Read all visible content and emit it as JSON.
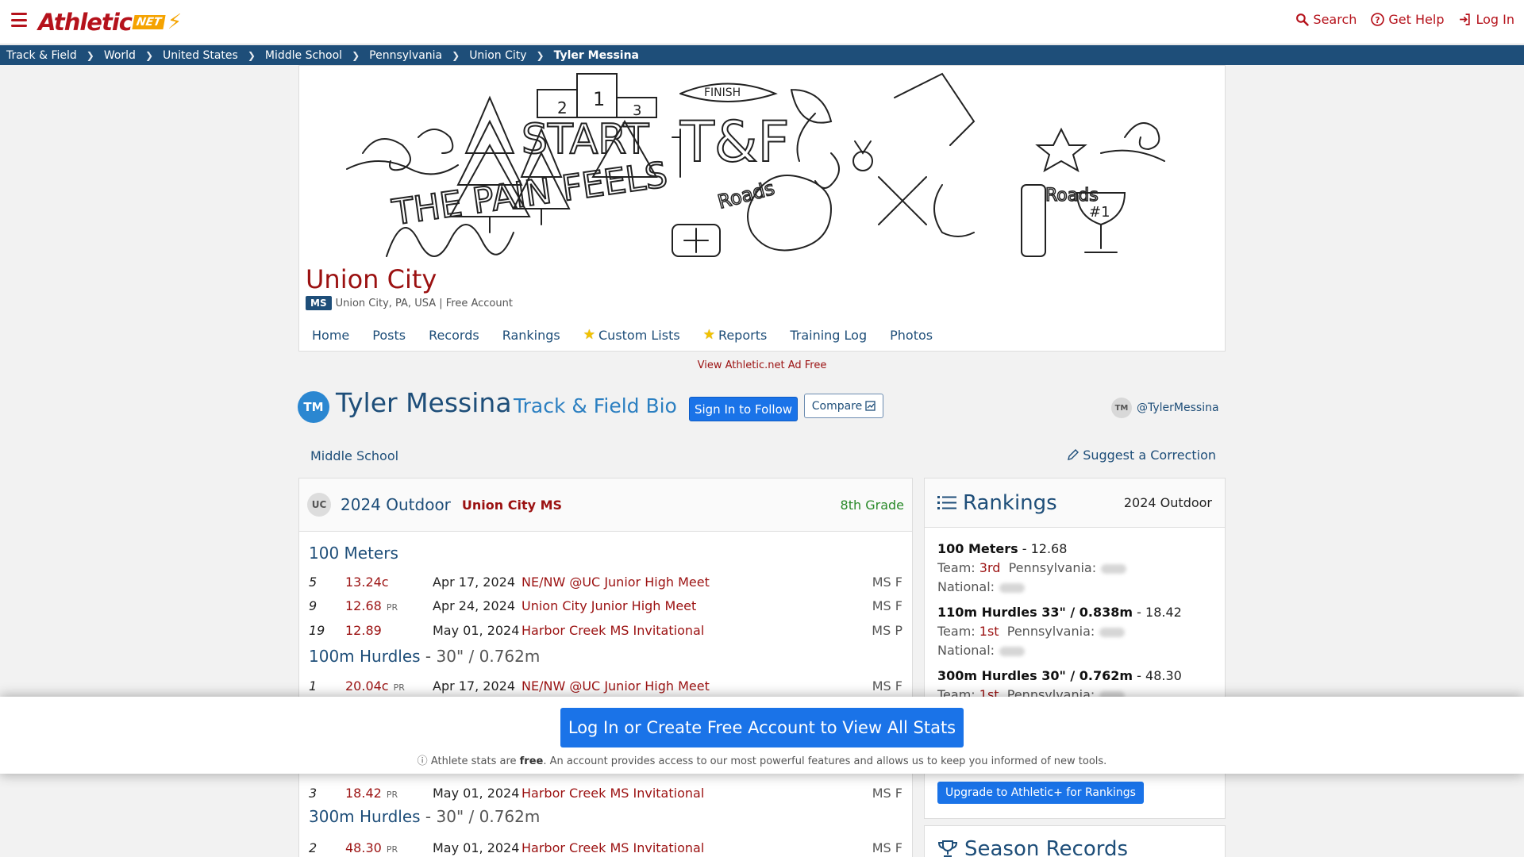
{
  "header": {
    "logo_text": "Athletic",
    "logo_net": "NET",
    "search": "Search",
    "help": "Get Help",
    "login": "Log In"
  },
  "breadcrumb": [
    "Track & Field",
    "World",
    "United States",
    "Middle School",
    "Pennsylvania",
    "Union City",
    "Tyler Messina"
  ],
  "team": {
    "name": "Union City",
    "badge": "MS",
    "meta": "Union City, PA, USA | Free Account",
    "nav": [
      "Home",
      "Posts",
      "Records",
      "Rankings",
      "Custom Lists",
      "Reports",
      "Training Log",
      "Photos"
    ]
  },
  "ad_free_link": "View Athletic.net Ad Free",
  "athlete": {
    "initials": "TM",
    "name": "Tyler Messina",
    "bio_label": "Track & Field Bio",
    "follow_btn": "Sign In to Follow",
    "compare_btn": "Compare",
    "handle_initials": "TM",
    "handle": "@TylerMessina",
    "level": "Middle School",
    "suggest": "Suggest a Correction"
  },
  "season_card": {
    "school_initials": "UC",
    "season": "2024 Outdoor",
    "school": "Union City MS",
    "grade": "8th Grade",
    "events": [
      {
        "name": "100 Meters",
        "sub": "",
        "results": [
          {
            "place": "5",
            "mark": "13.24c",
            "pr": "",
            "date": "Apr 17, 2024",
            "meet": "NE/NW @UC Junior High Meet",
            "div": "MS F"
          },
          {
            "place": "9",
            "mark": "12.68",
            "pr": "PR",
            "date": "Apr 24, 2024",
            "meet": "Union City Junior High Meet",
            "div": "MS F"
          },
          {
            "place": "19",
            "mark": "12.89",
            "pr": "",
            "date": "May 01, 2024",
            "meet": "Harbor Creek MS Invitational",
            "div": "MS P"
          }
        ]
      },
      {
        "name": "100m Hurdles",
        "sub": " - 30\" / 0.762m",
        "results": [
          {
            "place": "1",
            "mark": "20.04c",
            "pr": "PR",
            "date": "Apr 17, 2024",
            "meet": "NE/NW @UC Junior High Meet",
            "div": "MS F"
          }
        ]
      },
      {
        "name": "",
        "sub": "",
        "results": [
          {
            "place": "3",
            "mark": "18.42",
            "pr": "PR",
            "date": "May 01, 2024",
            "meet": "Harbor Creek MS Invitational",
            "div": "MS F"
          }
        ]
      },
      {
        "name": "300m Hurdles",
        "sub": " - 30\" / 0.762m",
        "results": [
          {
            "place": "2",
            "mark": "48.30",
            "pr": "PR",
            "date": "May 01, 2024",
            "meet": "Harbor Creek MS Invitational",
            "div": "MS F"
          }
        ]
      }
    ]
  },
  "rankings": {
    "title": "Rankings",
    "season": "2024 Outdoor",
    "items": [
      {
        "event": "100 Meters",
        "mark": " - 12.68",
        "team_label": "Team:",
        "team_rank": "3rd",
        "state_label": "Pennsylvania:",
        "national_label": "National:"
      },
      {
        "event": "110m Hurdles 33\" / 0.838m",
        "mark": " - 18.42",
        "team_label": "Team:",
        "team_rank": "1st",
        "state_label": "Pennsylvania:",
        "national_label": "National:"
      },
      {
        "event": "300m Hurdles 30\" / 0.762m",
        "mark": " - 48.30",
        "team_label": "Team:",
        "team_rank": "1st",
        "state_label": "Pennsylvania:",
        "national_label": ""
      }
    ],
    "upgrade_btn": "Upgrade to Athletic+ for Rankings"
  },
  "season_records": {
    "title": "Season Records"
  },
  "overlay": {
    "login_btn": "Log In or Create Free Account to View All Stats",
    "note_pre": "Athlete stats are ",
    "note_bold": "free",
    "note_post": ". An account provides access to our most powerful features and allows us to keep you informed of new tools."
  },
  "colors": {
    "brand_red": "#b5121b",
    "nav_blue": "#1e4e79",
    "button_blue": "#1a73e8",
    "accent_orange": "#f5a300"
  }
}
